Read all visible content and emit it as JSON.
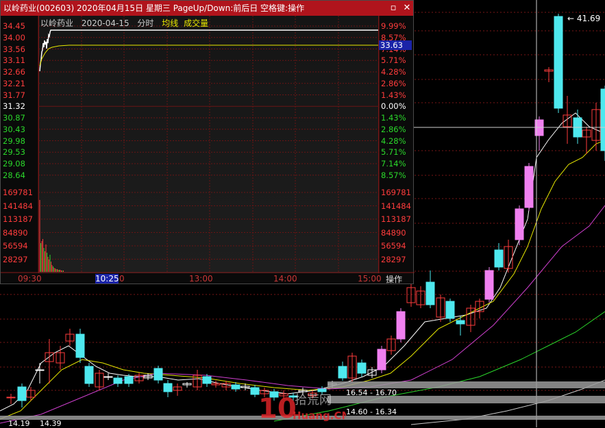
{
  "window": {
    "title": "以岭药业(002603)  2020年04月15日  星期三  PageUp/Down:前后日  空格键:操作"
  },
  "intraday": {
    "header_name": "以岭药业",
    "header_date": "2020-04-15",
    "header_mode": "分时",
    "header_avg": "均线",
    "header_vol": "成交量",
    "price_labels": [
      "34.45",
      "34.00",
      "33.56",
      "33.11",
      "32.66",
      "32.21",
      "31.77",
      "31.32",
      "30.87",
      "30.43",
      "29.98",
      "29.53",
      "29.08",
      "28.64"
    ],
    "pct_labels": [
      "9.99%",
      "8.57%",
      "7.14%",
      "5.71%",
      "4.28%",
      "2.86%",
      "1.43%",
      "0.00%",
      "1.43%",
      "2.86%",
      "4.28%",
      "5.71%",
      "7.14%",
      "8.57%"
    ],
    "volume_labels": [
      "169781",
      "141484",
      "113187",
      "84890",
      "56594",
      "28297"
    ],
    "time_labels": [
      "09:30",
      "10:25",
      "13:00",
      "14:00",
      "15:00"
    ],
    "current_price": "33.63",
    "cursor_time": "10:25",
    "ops_label": "操作",
    "colors": {
      "up": "#ff3c3c",
      "down": "#2bd82b",
      "neutral": "#ffffff",
      "avg": "#e8e800"
    }
  },
  "kline": {
    "max_label": "41.69",
    "ma_label_1": "16.54 - 16.70",
    "ma_label_2": "14.60 - 16.34",
    "min_label_1": "14.19",
    "min_label_2": "14.39"
  },
  "watermark": {
    "text_num": "10",
    "text_cn": "拾荒网",
    "text_en": "Huang.CN"
  }
}
